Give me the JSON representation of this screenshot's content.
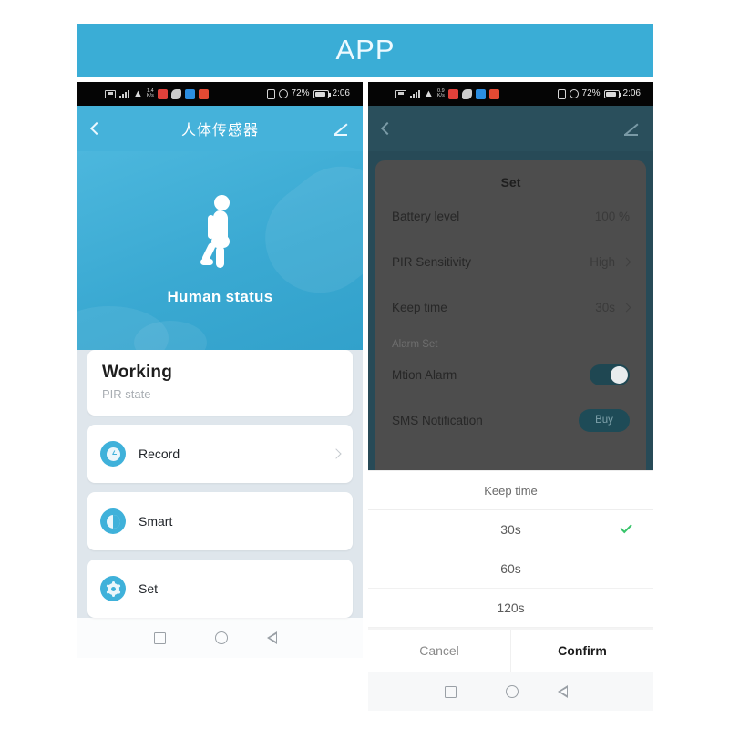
{
  "banner": {
    "title": "APP",
    "color": "#3aadd6"
  },
  "status_bar": {
    "battery_percent": "72%",
    "time": "2:06",
    "left_icons": [
      "sim-icon",
      "signal-bars-icon",
      "wifi-icon",
      "data-rate-icon",
      "app-badge-red-icon",
      "app-badge-gray-icon",
      "app-badge-blue-icon",
      "app-badge-red2-icon"
    ],
    "right_icons": [
      "nfc-icon",
      "alarm-icon",
      "battery-icon"
    ]
  },
  "left_phone": {
    "header": {
      "title": "人体传感器",
      "back_icon": "chevron-left-icon",
      "edit_icon": "pencil-icon"
    },
    "hero": {
      "illustration": "walking-person-icon",
      "label": "Human status"
    },
    "status_card": {
      "title": "Working",
      "subtitle": "PIR state"
    },
    "menu": [
      {
        "label": "Record",
        "icon": "clock-icon",
        "chevron": "chevron-right-icon"
      },
      {
        "label": "Smart",
        "icon": "half-circle-icon",
        "chevron": null
      },
      {
        "label": "Set",
        "icon": "gear-icon",
        "chevron": null
      }
    ]
  },
  "right_phone": {
    "header": {
      "back_icon": "chevron-left-icon",
      "edit_icon": "pencil-icon"
    },
    "set_panel": {
      "title": "Set",
      "rows": [
        {
          "label": "Battery level",
          "value": "100 %",
          "chevron": false
        },
        {
          "label": "PIR Sensitivity",
          "value": "High",
          "chevron": true
        },
        {
          "label": "Keep time",
          "value": "30s",
          "chevron": true
        }
      ],
      "section_header": "Alarm Set",
      "toggle_row": {
        "label": "Mtion Alarm",
        "state": "on"
      },
      "buy_row": {
        "label": "SMS Notification",
        "button_label": "Buy"
      }
    },
    "sheet": {
      "title": "Keep time",
      "options": [
        {
          "label": "30s",
          "selected": true
        },
        {
          "label": "60s",
          "selected": false
        },
        {
          "label": "120s",
          "selected": false
        }
      ],
      "cancel_label": "Cancel",
      "confirm_label": "Confirm",
      "check_color": "#37c46a"
    }
  },
  "nav_bar": {
    "recents": "square-icon",
    "home": "circle-icon",
    "back": "triangle-back-icon"
  }
}
